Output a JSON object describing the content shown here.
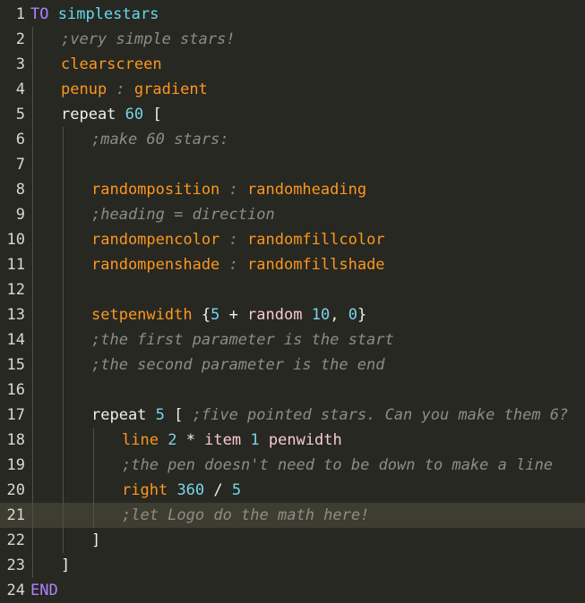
{
  "editor": {
    "lines": [
      {
        "n": "1",
        "indent": 0,
        "tokens": [
          [
            "TO",
            "kw-purple"
          ],
          [
            " ",
            ""
          ],
          [
            "simplestars",
            "fn-blue"
          ]
        ]
      },
      {
        "n": "2",
        "indent": 1,
        "tokens": [
          [
            ";very simple stars!",
            "comment"
          ]
        ]
      },
      {
        "n": "3",
        "indent": 1,
        "tokens": [
          [
            "clearscreen",
            "orange"
          ]
        ]
      },
      {
        "n": "4",
        "indent": 1,
        "tokens": [
          [
            "penup",
            "orange"
          ],
          [
            " : ",
            "comment"
          ],
          [
            "gradient",
            "orange"
          ]
        ]
      },
      {
        "n": "5",
        "indent": 1,
        "tokens": [
          [
            "repeat",
            "plain"
          ],
          [
            " ",
            ""
          ],
          [
            "60",
            "num"
          ],
          [
            " [",
            "plain"
          ]
        ]
      },
      {
        "n": "6",
        "indent": 2,
        "tokens": [
          [
            ";make 60 stars:",
            "comment"
          ]
        ]
      },
      {
        "n": "7",
        "indent": 2,
        "tokens": []
      },
      {
        "n": "8",
        "indent": 2,
        "tokens": [
          [
            "randomposition",
            "orange"
          ],
          [
            " : ",
            "comment"
          ],
          [
            "randomheading",
            "orange"
          ]
        ]
      },
      {
        "n": "9",
        "indent": 2,
        "tokens": [
          [
            ";heading = direction",
            "comment"
          ]
        ]
      },
      {
        "n": "10",
        "indent": 2,
        "tokens": [
          [
            "randompencolor",
            "orange"
          ],
          [
            " : ",
            "comment"
          ],
          [
            "randomfillcolor",
            "orange"
          ]
        ]
      },
      {
        "n": "11",
        "indent": 2,
        "tokens": [
          [
            "randompenshade",
            "orange"
          ],
          [
            " : ",
            "comment"
          ],
          [
            "randomfillshade",
            "orange"
          ]
        ]
      },
      {
        "n": "12",
        "indent": 2,
        "tokens": []
      },
      {
        "n": "13",
        "indent": 2,
        "tokens": [
          [
            "setpenwidth",
            "orange"
          ],
          [
            " {",
            "plain"
          ],
          [
            "5",
            "num"
          ],
          [
            " + ",
            "plain"
          ],
          [
            "random",
            "pink"
          ],
          [
            " ",
            ""
          ],
          [
            "10",
            "num"
          ],
          [
            ", ",
            "plain"
          ],
          [
            "0",
            "num"
          ],
          [
            "}",
            "plain"
          ]
        ]
      },
      {
        "n": "14",
        "indent": 2,
        "tokens": [
          [
            ";the first parameter is the start",
            "comment"
          ]
        ]
      },
      {
        "n": "15",
        "indent": 2,
        "tokens": [
          [
            ";the second parameter is the end",
            "comment"
          ]
        ]
      },
      {
        "n": "16",
        "indent": 2,
        "tokens": []
      },
      {
        "n": "17",
        "indent": 2,
        "tokens": [
          [
            "repeat",
            "plain"
          ],
          [
            " ",
            ""
          ],
          [
            "5",
            "num"
          ],
          [
            " [ ",
            "plain"
          ],
          [
            ";five pointed stars. Can you make them 6?",
            "comment"
          ]
        ]
      },
      {
        "n": "18",
        "indent": 3,
        "tokens": [
          [
            "line",
            "orange"
          ],
          [
            " ",
            ""
          ],
          [
            "2",
            "num"
          ],
          [
            " * ",
            "plain"
          ],
          [
            "item",
            "pink"
          ],
          [
            " ",
            ""
          ],
          [
            "1",
            "num"
          ],
          [
            " ",
            ""
          ],
          [
            "penwidth",
            "pink"
          ]
        ]
      },
      {
        "n": "19",
        "indent": 3,
        "tokens": [
          [
            ";the pen doesn't need to be down to make a line",
            "comment"
          ]
        ]
      },
      {
        "n": "20",
        "indent": 3,
        "tokens": [
          [
            "right",
            "orange"
          ],
          [
            " ",
            ""
          ],
          [
            "360",
            "num"
          ],
          [
            " / ",
            "plain"
          ],
          [
            "5",
            "num"
          ]
        ]
      },
      {
        "n": "21",
        "indent": 3,
        "active": true,
        "tokens": [
          [
            ";let Logo do the math here!",
            "comment"
          ]
        ]
      },
      {
        "n": "22",
        "indent": 2,
        "tokens": [
          [
            "]",
            "plain"
          ]
        ]
      },
      {
        "n": "23",
        "indent": 1,
        "tokens": [
          [
            "]",
            "plain"
          ]
        ]
      },
      {
        "n": "24",
        "indent": 0,
        "tokens": [
          [
            "END",
            "kw-purple"
          ]
        ]
      }
    ]
  },
  "colors": {
    "background": "#272822",
    "active_line": "#3e3d32",
    "keyword": "#ae81ff",
    "procedure_name": "#66d9ef",
    "command": "#fd971f",
    "reporter": "#f8c8d4",
    "number": "#7ad3ea",
    "comment": "#8d8d84"
  }
}
